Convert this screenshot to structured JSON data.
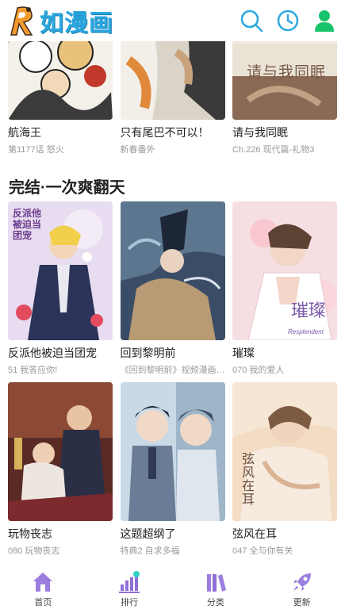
{
  "header": {
    "logo_text": "如漫画",
    "logo_letter": "R",
    "icons": [
      "search-icon",
      "history-icon",
      "user-icon"
    ],
    "accent": "#2aa7df"
  },
  "row0": [
    {
      "title": "航海王",
      "subtitle": "第1177话 怒火"
    },
    {
      "title": "只有尾巴不可以！",
      "subtitle": "新春番外"
    },
    {
      "title": "请与我同眠",
      "subtitle": "Ch.226 现代篇-礼物3",
      "cover_text": "请与我同眠"
    }
  ],
  "section": {
    "title": "完结·一次爽翻天"
  },
  "row1": [
    {
      "title": "反派他被迫当团宠",
      "subtitle": "51 我答应你!",
      "cover_text": "反派他被迫当团宠"
    },
    {
      "title": "回到黎明前",
      "subtitle": "《回到黎明前》视频漫画上线啦"
    },
    {
      "title": "璀璨",
      "subtitle": "070 我的爱人",
      "cover_text": "璀璨",
      "cover_sub": "Resplendent"
    }
  ],
  "row2": [
    {
      "title": "玩物丧志",
      "subtitle": "080 玩物丧志"
    },
    {
      "title": "这题超纲了",
      "subtitle": "特典2 自求多福"
    },
    {
      "title": "弦风在耳",
      "subtitle": "047 全与你有关",
      "cover_text": "弦风在耳"
    }
  ],
  "tabbar": [
    {
      "label": "首页",
      "icon": "home-icon"
    },
    {
      "label": "排行",
      "icon": "ranking-icon"
    },
    {
      "label": "分类",
      "icon": "category-icon"
    },
    {
      "label": "更新",
      "icon": "rocket-icon"
    }
  ],
  "colors": {
    "accent": "#2aa7df",
    "tab_icon": "#8f6fd6",
    "user_icon": "#19c36b"
  }
}
